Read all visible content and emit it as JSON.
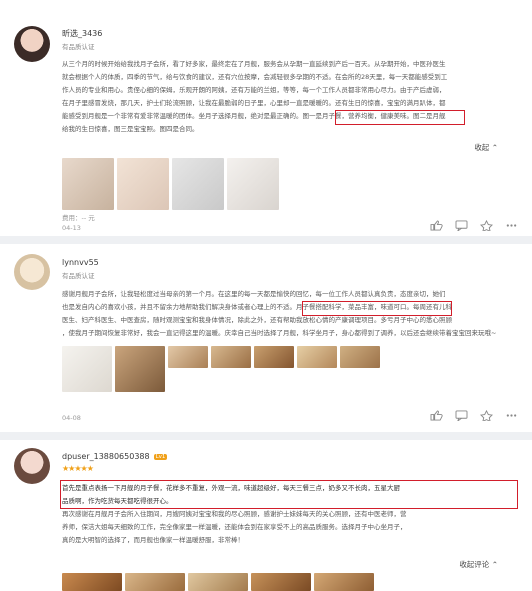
{
  "reviews": [
    {
      "user": "昕选_3436",
      "cert": "有品质认证",
      "text_lines": [
        "从三个月的时候开始给我找月子会所，看了好多家，最终定在了月舰，服务会从孕期一直延续到产后一百天。从孕期开始，中医孙医生",
        "就会根据个人的体质，四季的节气，给与饮食的建议，还有穴位按摩，会减轻很多孕期的不适。在会所的28天里，每一天都能感受到工",
        "作人员的专业和用心。贵侄心细的保姆，乐观开朗的阿姨，还有万能的兰姐，等等，每一个工作人员都非常用心尽力。由于产后虚弱，",
        "在月子里感冒发烧，那几天，护士们轮流照顾，让我在最脆弱的日子里，心里却一直是暖暖的。还有生日的惊喜，宝宝的满月趴体，都",
        "能感受到月舰是一个非常有爱非常温暖的团体。坐月子选择月舰，绝对是最正确的。图一是月子餐，营养均衡，健康美味。图二是月舰",
        "给我的生日惊喜，图三是宝宝照。图四是合同。"
      ],
      "highlight": "图一是月子餐，营养均衡，健康美味。",
      "collapse": "收起",
      "meta": "费用：-- 元",
      "date": "04-13"
    },
    {
      "user": "lynnvv55",
      "cert": "有品质认证",
      "text_lines": [
        "感谢月舰月子会所，让我轻松度过当母亲的第一个月。在这里的每一天都是愉快的回忆，每一位工作人员都认真负责，态度亲切，她们",
        "也是发自内心的喜欢小孩，并且不留余力地帮助我们解决身体或者心理上的不适。月子餐搭配科学，菜品丰富，味道可口。每周还有儿科",
        "医生、妇产科医生、中医查房，随时观测宝宝和我身体情况，除此之外，还有帮助我放松心情的产康调理项目。多亏月子中心的悉心照顾",
        "，使我月子期间恢复非常好，我会一直记得这里的温暖。庆幸自己当时选择了月舰，科学坐月子，身心都得到了调养，以后还会继续带着宝宝回来玩哦~"
      ],
      "highlight": "月子餐搭配科学，菜品丰富，味道可口。",
      "date": "04-08"
    },
    {
      "user": "dpuser_13880650388",
      "level": "Lv1",
      "text_lines": [
        "首先是重点表扬一下月舰的月子餐，花样多不重复，外观一流，味道超级好，每天三餐三点，奶多又不长肉，五星大厨",
        "品质啊，作为吃货每天都吃得很开心。",
        "再次感谢在月舰月子会所入住期间，月嫂阿姨对宝宝和我的尽心照顾，感谢护士妹妹每天的关心照顾，还有中医老师，营",
        "养师，保洁大姐每天细致的工作，完全像家里一样温暖，还能体会到在家享受不上的高品质服务。选择月子中心坐月子，",
        "真的是大明智的选择了，而月舰也像家一样温暖舒服，非常棒！"
      ],
      "highlight": "首先是重点表扬一下月舰的月子餐，花样多不重复，外观一流，味道超级好，每天三餐三点，奶多又不长肉，五星大厨品质啊，作为吃货每天都吃得很开心。",
      "collapse": "收起评论"
    }
  ],
  "colors": {
    "highlight": "#d21e2b",
    "divider": "#eef0f3"
  }
}
